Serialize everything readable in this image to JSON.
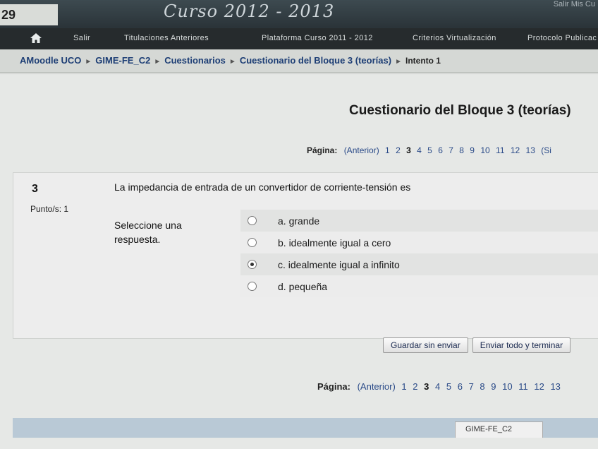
{
  "banner": {
    "year_fragment": "29",
    "title": "Curso 2012 - 2013",
    "top_right": "Salir  Mis Cu"
  },
  "nav": {
    "items": [
      "Salir",
      "Titulaciones Anteriores",
      "Plataforma Curso 2011 - 2012",
      "Criterios Virtualización",
      "Protocolo Publicac"
    ]
  },
  "breadcrumb": {
    "items": [
      "AMoodle UCO",
      "GIME-FE_C2",
      "Cuestionarios",
      "Cuestionario del Bloque 3 (teorías)"
    ],
    "separator": "►",
    "current": "Intento 1"
  },
  "quiz": {
    "title": "Cuestionario del Bloque 3 (teorías)"
  },
  "pager_top": {
    "label": "Página:",
    "prev": "(Anterior)",
    "pages": [
      "1",
      "2",
      "3",
      "4",
      "5",
      "6",
      "7",
      "8",
      "9",
      "10",
      "11",
      "12",
      "13",
      "(Si"
    ],
    "current": "3"
  },
  "question": {
    "number": "3",
    "text": "La impedancia de entrada de un convertidor de corriente-tensión es",
    "points": "Punto/s: 1",
    "prompt": "Seleccione una respuesta.",
    "answers": [
      {
        "label": "a. grande",
        "selected": false
      },
      {
        "label": "b. idealmente igual a cero",
        "selected": false
      },
      {
        "label": "c. idealmente igual a infinito",
        "selected": true
      },
      {
        "label": "d. pequeña",
        "selected": false
      }
    ]
  },
  "buttons": {
    "save": "Guardar sin enviar",
    "submit": "Enviar todo y terminar"
  },
  "pager_bottom": {
    "label": "Página:",
    "prev": "(Anterior)",
    "pages": [
      "1",
      "2",
      "3",
      "4",
      "5",
      "6",
      "7",
      "8",
      "9",
      "10",
      "11",
      "12",
      "13"
    ],
    "current": "3"
  },
  "footer": {
    "tag": "GIME-FE_C2"
  }
}
